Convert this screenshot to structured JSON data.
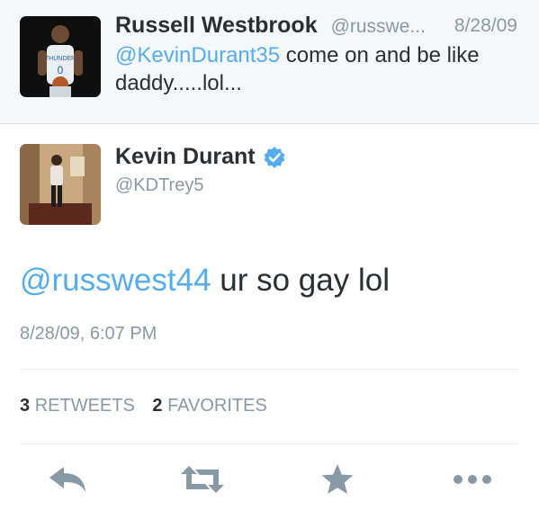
{
  "reply_tweet": {
    "author_name": "Russell Westbrook",
    "author_handle": "@russwe...",
    "date": "8/28/09",
    "text_mention": "@KevinDurant35",
    "text_body": " come on and be like daddy.....lol..."
  },
  "main_tweet": {
    "author_name": "Kevin Durant",
    "author_handle": "@KDTrey5",
    "verified": true,
    "text_mention": "@russwest44",
    "text_body": " ur so gay lol",
    "timestamp": "8/28/09, 6:07 PM"
  },
  "stats": {
    "retweets_count": "3",
    "retweets_label": "RETWEETS",
    "favorites_count": "2",
    "favorites_label": "FAVORITES"
  },
  "actions": {
    "icons": [
      "reply-icon",
      "retweet-icon",
      "favorite-icon",
      "more-icon"
    ]
  },
  "colors": {
    "link": "#55acee",
    "muted": "#8899a6",
    "text": "#292f33",
    "reply_background": "#f5f8fa",
    "action_icon": "#8899a6"
  }
}
